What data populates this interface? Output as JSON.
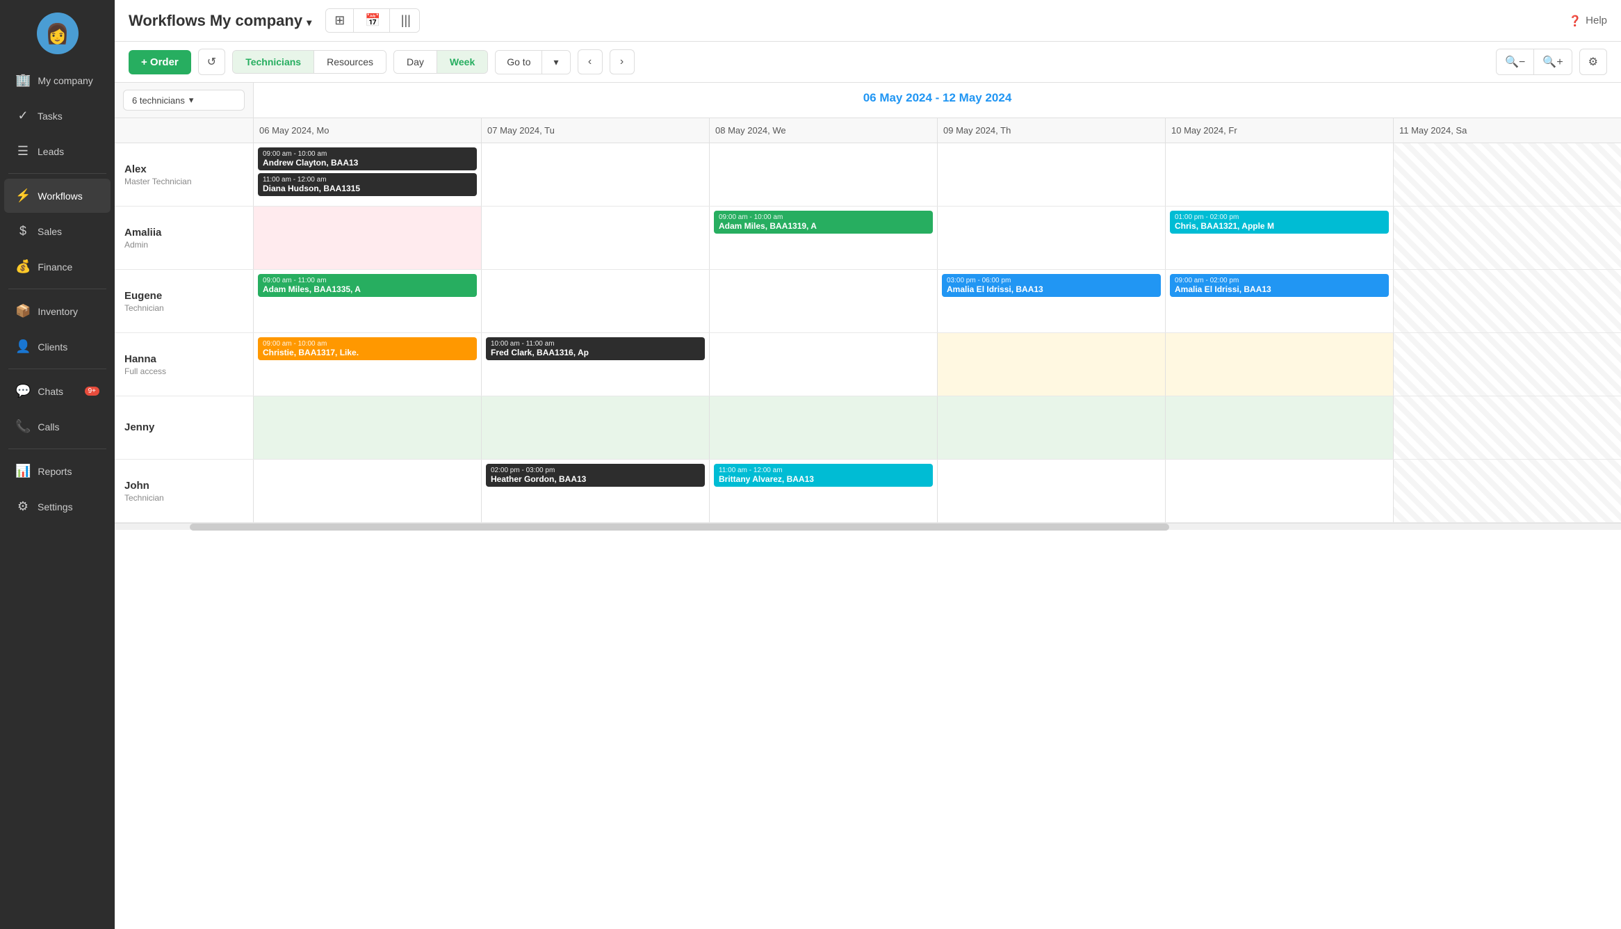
{
  "sidebar": {
    "avatar_emoji": "👩",
    "items": [
      {
        "id": "my-company",
        "label": "My company",
        "icon": "🏢",
        "active": false
      },
      {
        "id": "tasks",
        "label": "Tasks",
        "icon": "✓",
        "active": false
      },
      {
        "id": "leads",
        "label": "Leads",
        "icon": "☰",
        "active": false
      },
      {
        "id": "workflows",
        "label": "Workflows",
        "icon": "⚡",
        "active": true
      },
      {
        "id": "sales",
        "label": "Sales",
        "icon": "$",
        "active": false
      },
      {
        "id": "finance",
        "label": "Finance",
        "icon": "💰",
        "active": false
      },
      {
        "id": "inventory",
        "label": "Inventory",
        "icon": "📦",
        "active": false
      },
      {
        "id": "clients",
        "label": "Clients",
        "icon": "👤",
        "active": false
      },
      {
        "id": "chats",
        "label": "Chats",
        "icon": "💬",
        "active": false,
        "badge": "9+"
      },
      {
        "id": "calls",
        "label": "Calls",
        "icon": "📞",
        "active": false
      },
      {
        "id": "reports",
        "label": "Reports",
        "icon": "📊",
        "active": false
      },
      {
        "id": "settings",
        "label": "Settings",
        "icon": "⚙",
        "active": false
      }
    ]
  },
  "header": {
    "title_prefix": "Workflows",
    "title_company": "My company",
    "dropdown_icon": "▾",
    "view_icons": [
      "⊞",
      "📅",
      "|||"
    ],
    "help_label": "Help"
  },
  "toolbar": {
    "order_btn": "+ Order",
    "refresh_icon": "↺",
    "tabs": [
      {
        "id": "technicians",
        "label": "Technicians",
        "active": true
      },
      {
        "id": "resources",
        "label": "Resources",
        "active": false
      }
    ],
    "view_tabs": [
      {
        "id": "day",
        "label": "Day",
        "active": false
      },
      {
        "id": "week",
        "label": "Week",
        "active": true
      }
    ],
    "goto_label": "Go to",
    "goto_dropdown": "▾",
    "prev_icon": "‹",
    "next_icon": "›",
    "zoom_out": "🔍",
    "zoom_in": "🔍",
    "settings_icon": "⚙"
  },
  "calendar": {
    "date_range": "06 May 2024 - 12 May 2024",
    "tech_filter": "6 technicians",
    "dates": [
      {
        "label": "06 May 2024, Mo"
      },
      {
        "label": "07 May 2024, Tu"
      },
      {
        "label": "08 May 2024, We"
      },
      {
        "label": "09 May 2024, Th"
      },
      {
        "label": "10 May 2024, Fr"
      },
      {
        "label": "11 May 2024, Sa",
        "weekend": true
      }
    ],
    "technicians": [
      {
        "name": "Alex",
        "role": "Master Technician",
        "days": [
          {
            "events": [
              {
                "time": "09:00 am - 10:00 am",
                "name": "Andrew Clayton",
                "code": "BAA13",
                "color": "dark"
              },
              {
                "time": "11:00 am - 12:00 am",
                "name": "Diana Hudson",
                "code": "BAA1315",
                "color": "dark"
              }
            ]
          },
          {
            "events": []
          },
          {
            "events": []
          },
          {
            "events": []
          },
          {
            "events": []
          },
          {
            "events": [],
            "weekend": true
          }
        ]
      },
      {
        "name": "Amaliia",
        "role": "Admin",
        "days": [
          {
            "events": [],
            "bg": "pink"
          },
          {
            "events": []
          },
          {
            "events": [
              {
                "time": "09:00 am - 10:00 am",
                "name": "Adam Miles",
                "code": "BAA1319, A",
                "color": "green"
              }
            ]
          },
          {
            "events": []
          },
          {
            "events": [
              {
                "time": "01:00 pm - 02:00 pm",
                "name": "Chris",
                "code": "BAA1321, Apple M",
                "color": "teal"
              }
            ]
          },
          {
            "events": [],
            "weekend": true
          }
        ]
      },
      {
        "name": "Eugene",
        "role": "Technician",
        "days": [
          {
            "events": [
              {
                "time": "09:00 am - 11:00 am",
                "name": "Adam Miles",
                "code": "BAA1335, A",
                "color": "green"
              }
            ]
          },
          {
            "events": []
          },
          {
            "events": []
          },
          {
            "events": [
              {
                "time": "03:00 pm - 06:00 pm",
                "name": "Amalia El Idrissi",
                "code": "BAA13",
                "color": "blue"
              }
            ]
          },
          {
            "events": [
              {
                "time": "09:00 am - 02:00 pm",
                "name": "Amalia El Idrissi",
                "code": "BAA13",
                "color": "blue"
              }
            ]
          },
          {
            "events": [],
            "weekend": true
          }
        ]
      },
      {
        "name": "Hanna",
        "role": "Full access",
        "days": [
          {
            "events": [
              {
                "time": "09:00 am - 10:00 am",
                "name": "Christie",
                "code": "BAA1317, Like.",
                "color": "orange"
              }
            ]
          },
          {
            "events": [
              {
                "time": "10:00 am - 11:00 am",
                "name": "Fred Clark",
                "code": "BAA1316, Ap",
                "color": "dark"
              }
            ]
          },
          {
            "events": []
          },
          {
            "events": [],
            "bg": "peach"
          },
          {
            "events": [],
            "bg": "peach"
          },
          {
            "events": [],
            "weekend": true
          }
        ]
      },
      {
        "name": "Jenny",
        "role": "",
        "days": [
          {
            "events": [],
            "bg": "light-green"
          },
          {
            "events": [],
            "bg": "light-green"
          },
          {
            "events": [],
            "bg": "light-green"
          },
          {
            "events": [],
            "bg": "light-green"
          },
          {
            "events": [],
            "bg": "light-green"
          },
          {
            "events": [],
            "weekend": true
          }
        ]
      },
      {
        "name": "John",
        "role": "Technician",
        "days": [
          {
            "events": []
          },
          {
            "events": [
              {
                "time": "02:00 pm - 03:00 pm",
                "name": "Heather Gordon",
                "code": "BAA13",
                "color": "dark"
              }
            ]
          },
          {
            "events": [
              {
                "time": "11:00 am - 12:00 am",
                "name": "Brittany Alvarez",
                "code": "BAA13",
                "color": "teal"
              }
            ]
          },
          {
            "events": []
          },
          {
            "events": []
          },
          {
            "events": [],
            "weekend": true
          }
        ]
      }
    ]
  }
}
